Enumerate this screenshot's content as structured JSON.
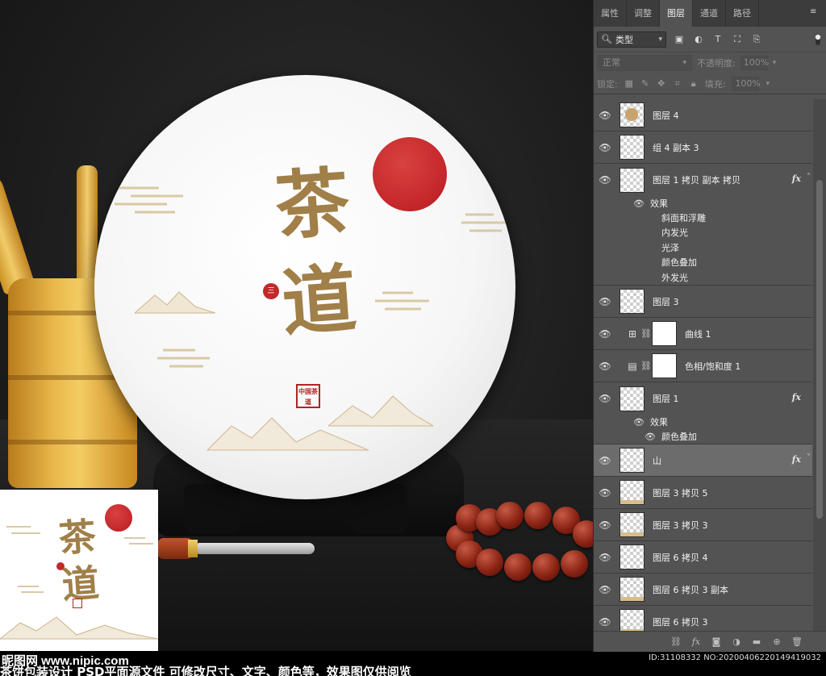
{
  "watermark": {
    "site_brand": "昵图网 www.nipic.com",
    "id": "ID:31108332 NO:20200406220149419032",
    "caption": "茶饼包装设计 PSD平面源文件 可修改尺寸、文字、颜色等，效果图仅供阅览"
  },
  "artwork": {
    "calligraphy": "茶道",
    "seal_small": "三",
    "seal_square": "中国茶道"
  },
  "panel": {
    "tabs": [
      "属性",
      "调整",
      "图层",
      "通道",
      "路径"
    ],
    "active_tab": "图层",
    "filter": {
      "label": "类型"
    },
    "blend_mode": "正常",
    "opacity_label": "不透明度:",
    "opacity_value": "100%",
    "lock_label": "锁定:",
    "fill_label": "填充:",
    "fill_value": "100%",
    "effects_label": "效果",
    "layers": [
      {
        "name": "图层 4",
        "type": "pixel",
        "thumb": "art"
      },
      {
        "name": "组 4 副本 3",
        "type": "pixel",
        "thumb": "empty"
      },
      {
        "name": "图层 1 拷贝 副本 拷贝",
        "type": "pixel",
        "thumb": "empty",
        "fx": true,
        "effects": [
          "斜面和浮雕",
          "内发光",
          "光泽",
          "颜色叠加",
          "外发光"
        ]
      },
      {
        "name": "图层 3",
        "type": "pixel",
        "thumb": "empty"
      },
      {
        "name": "曲线 1",
        "type": "adjustment",
        "icon": "curves-icon"
      },
      {
        "name": "色相/饱和度 1",
        "type": "adjustment",
        "icon": "hue-saturation-icon"
      },
      {
        "name": "图层 1",
        "type": "pixel",
        "thumb": "empty",
        "fx": true,
        "effects": [
          "颜色叠加"
        ]
      },
      {
        "name": "山",
        "type": "pixel",
        "thumb": "empty",
        "fx": true,
        "selected": true
      },
      {
        "name": "图层 3 拷贝 5",
        "type": "pixel",
        "thumb": "sliver"
      },
      {
        "name": "图层 3 拷贝 3",
        "type": "pixel",
        "thumb": "sliver"
      },
      {
        "name": "图层 6 拷贝 4",
        "type": "pixel",
        "thumb": "empty"
      },
      {
        "name": "图层 6 拷贝 3 副本",
        "type": "pixel",
        "thumb": "sliver"
      },
      {
        "name": "图层 6 拷贝 3",
        "type": "pixel",
        "thumb": "sliver"
      }
    ],
    "fx_label": "fx",
    "colors": {
      "panel_bg": "#535353",
      "tab_bg": "#3c3c3c",
      "selected_row": "#6c6c6c"
    }
  }
}
